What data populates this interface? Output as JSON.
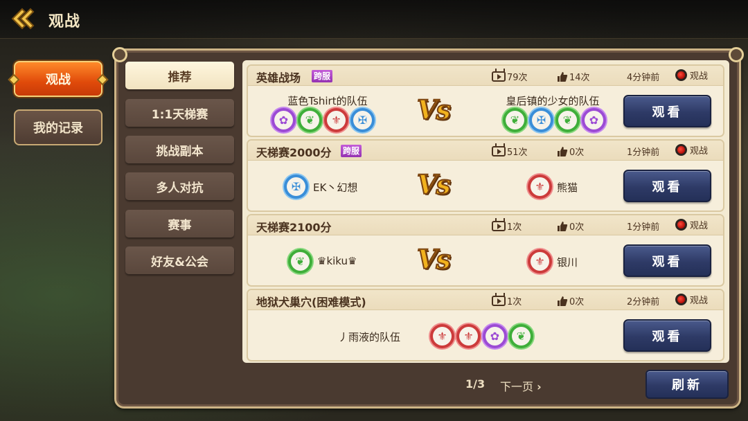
{
  "header": {
    "title": "观战"
  },
  "side_tabs": [
    {
      "label": "观战",
      "active": true
    },
    {
      "label": "我的记录",
      "active": false
    }
  ],
  "categories": [
    {
      "label": "推荐",
      "active": true
    },
    {
      "label": "1:1天梯赛",
      "active": false
    },
    {
      "label": "挑战副本",
      "active": false
    },
    {
      "label": "多人对抗",
      "active": false
    },
    {
      "label": "赛事",
      "active": false
    },
    {
      "label": "好友&公会",
      "active": false
    }
  ],
  "matches": [
    {
      "title": "英雄战场",
      "badge": "跨服",
      "views": "79次",
      "likes": "14次",
      "time": "4分钟前",
      "live_label": "观战",
      "left_team": "蓝色Tshirt的队伍",
      "left_icons": [
        "purple",
        "green",
        "red",
        "blue"
      ],
      "right_team": "皇后镇的少女的队伍",
      "right_icons": [
        "green",
        "blue",
        "green",
        "purple"
      ],
      "vs": "Vs",
      "button": "观看"
    },
    {
      "title": "天梯赛2000分",
      "badge": "跨服",
      "views": "51次",
      "likes": "0次",
      "time": "1分钟前",
      "live_label": "观战",
      "left_team": "EK丶幻想",
      "left_icons": [
        "blue"
      ],
      "right_team": "熊猫",
      "right_icons": [
        "red"
      ],
      "vs": "Vs",
      "button": "观看"
    },
    {
      "title": "天梯赛2100分",
      "badge": "",
      "views": "1次",
      "likes": "0次",
      "time": "1分钟前",
      "live_label": "观战",
      "left_team": "♛kiku♛",
      "left_icons": [
        "green"
      ],
      "right_team": "银川",
      "right_icons": [
        "red"
      ],
      "vs": "Vs",
      "button": "观看"
    },
    {
      "title": "地狱犬巢穴(困难模式)",
      "badge": "",
      "views": "1次",
      "likes": "0次",
      "time": "2分钟前",
      "live_label": "观战",
      "left_team": "丿雨液的队伍",
      "left_icons": [
        "red",
        "red",
        "purple",
        "green"
      ],
      "right_team": "",
      "right_icons": [],
      "vs": "",
      "button": "观看"
    }
  ],
  "pagination": {
    "current": "1/3",
    "next_label": "下一页"
  },
  "refresh_label": "刷新",
  "colors": {
    "accent_orange": "#e04a0a",
    "button_navy": "#2e3a66",
    "badge_purple": "#9432b2",
    "live_red": "#d21a12"
  }
}
